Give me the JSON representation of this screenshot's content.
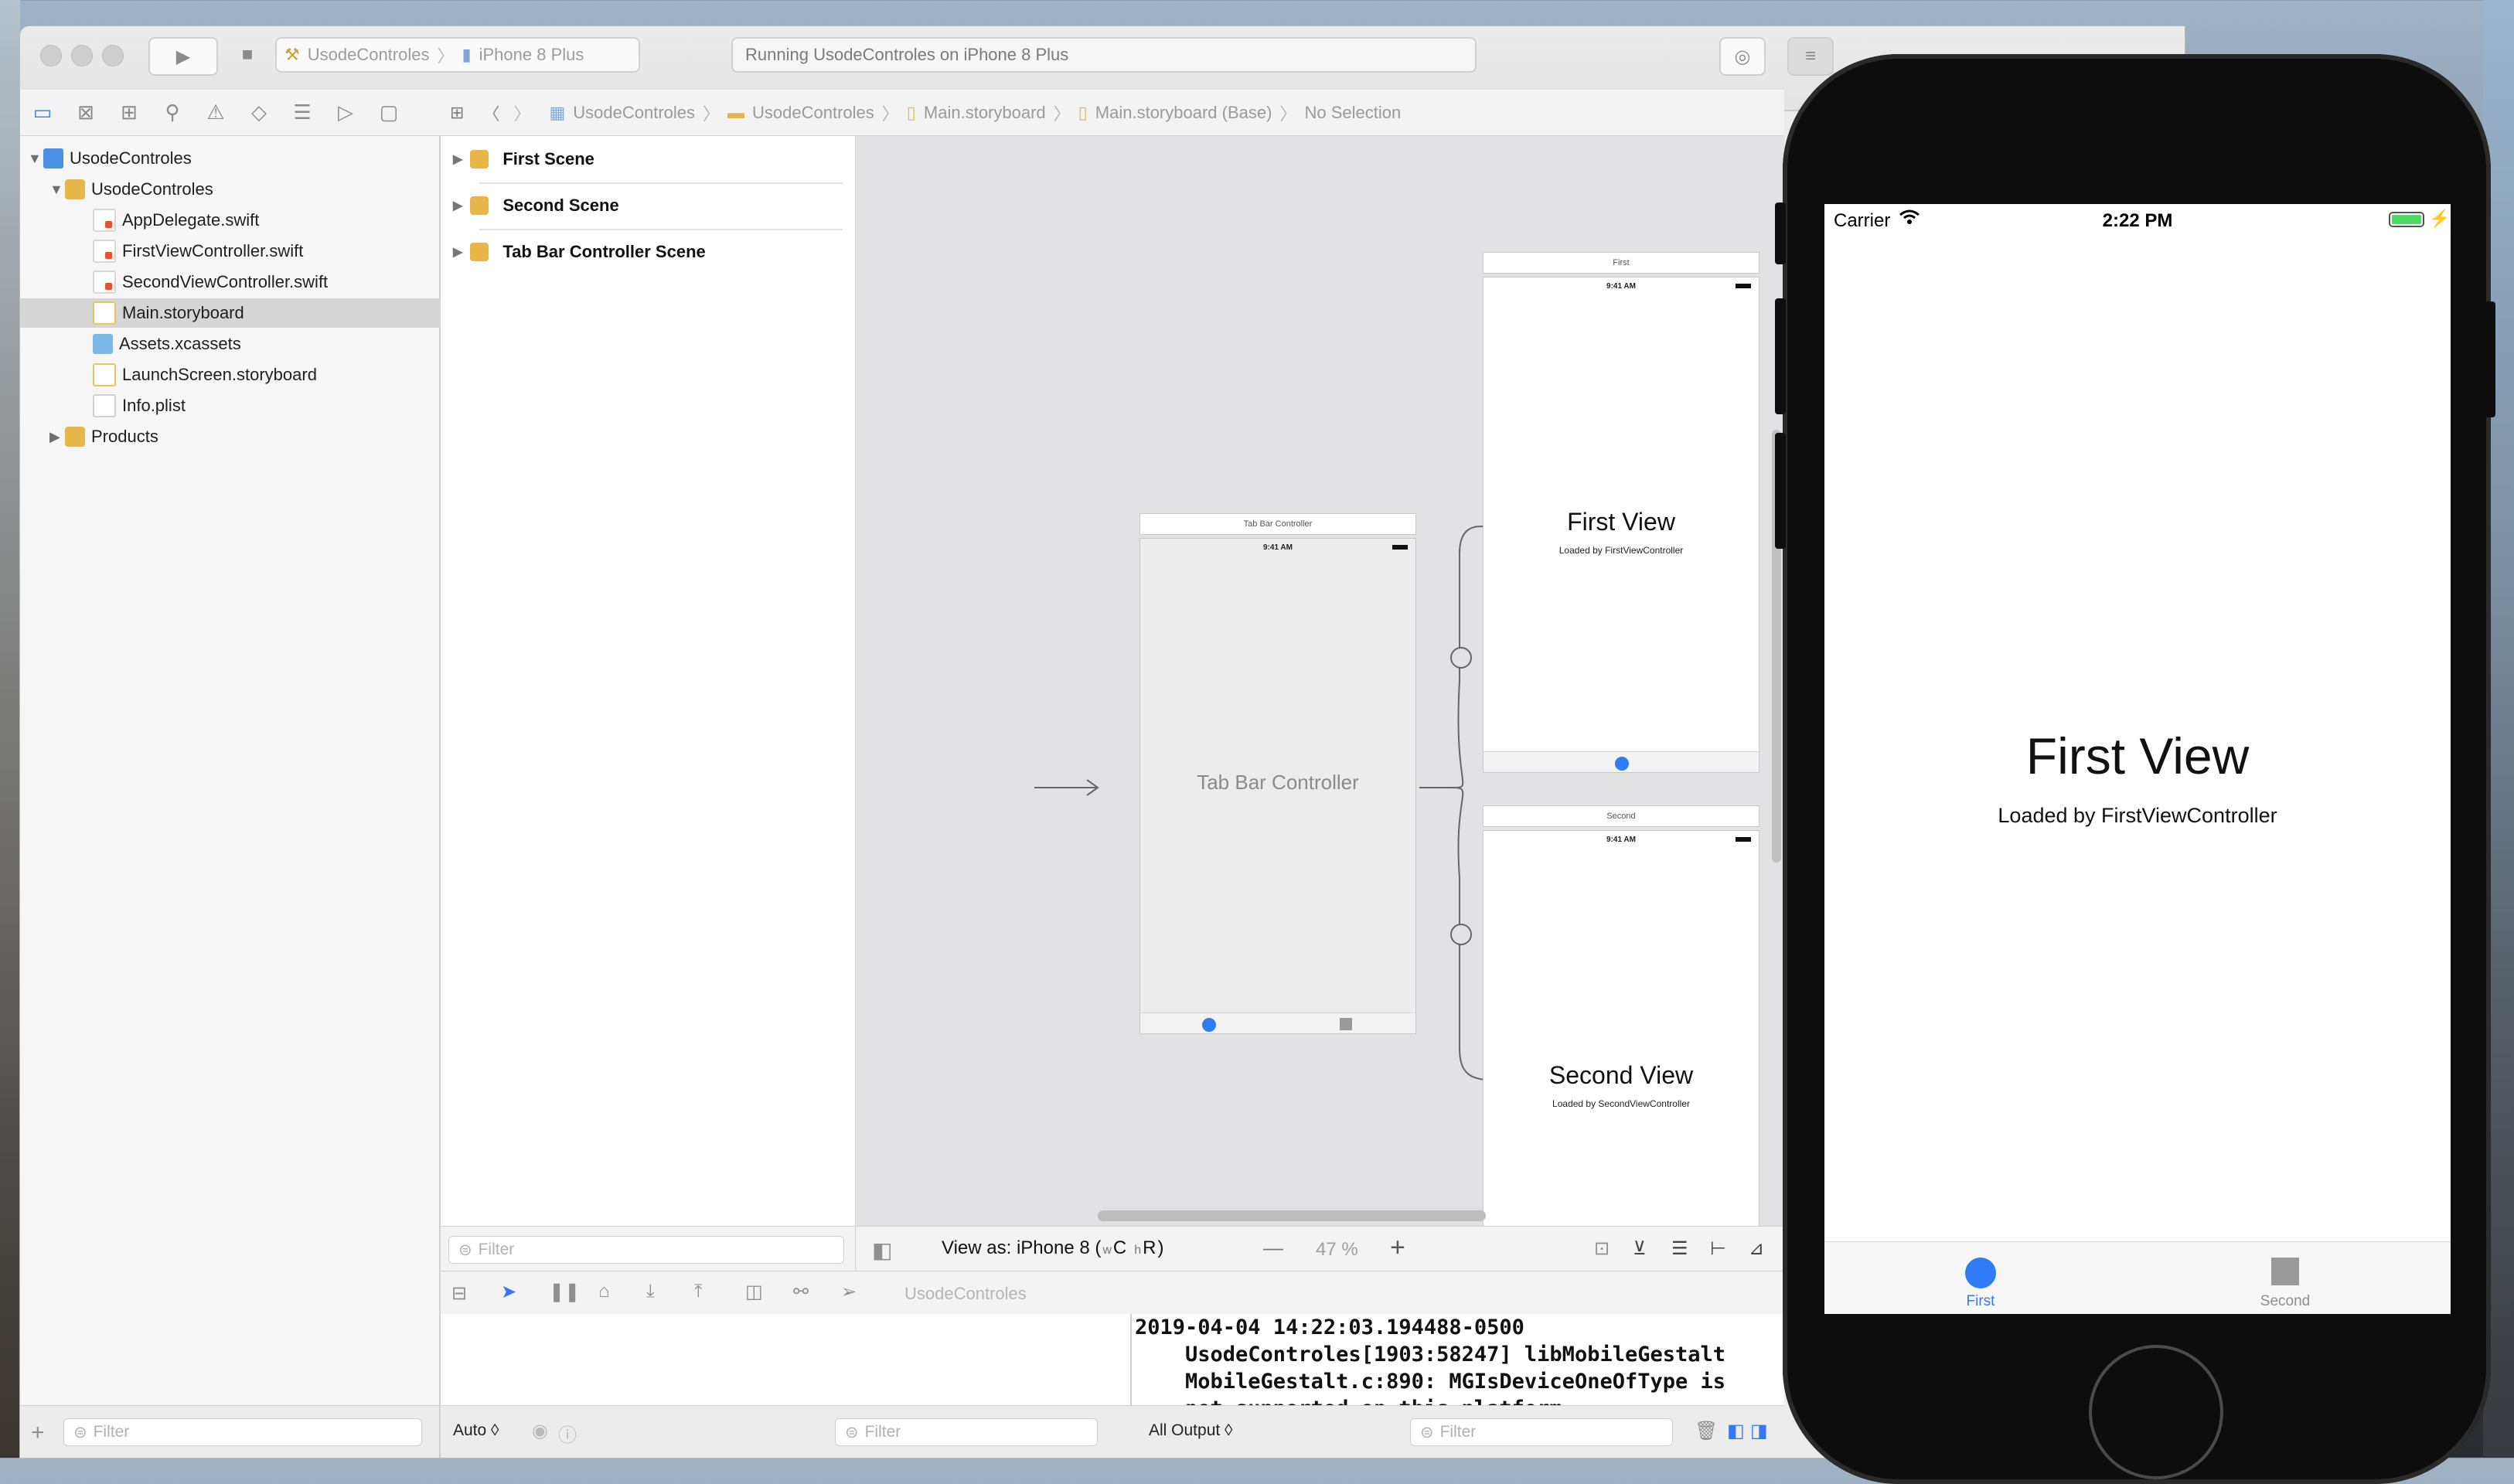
{
  "toolbar": {
    "scheme_project": "UsodeControles",
    "scheme_device": "iPhone 8 Plus",
    "activity": "Running UsodeControles on iPhone 8 Plus"
  },
  "navigator": {
    "items": [
      {
        "label": "UsodeControles",
        "type": "project"
      },
      {
        "label": "UsodeControles",
        "type": "folder"
      },
      {
        "label": "AppDelegate.swift",
        "type": "swift"
      },
      {
        "label": "FirstViewController.swift",
        "type": "swift"
      },
      {
        "label": "SecondViewController.swift",
        "type": "swift"
      },
      {
        "label": "Main.storyboard",
        "type": "storyboard",
        "selected": true
      },
      {
        "label": "Assets.xcassets",
        "type": "assets"
      },
      {
        "label": "LaunchScreen.storyboard",
        "type": "storyboard"
      },
      {
        "label": "Info.plist",
        "type": "plist"
      },
      {
        "label": "Products",
        "type": "folder"
      }
    ],
    "filter_placeholder": "Filter"
  },
  "jumpbar": {
    "crumbs": [
      "UsodeControles",
      "UsodeControles",
      "Main.storyboard",
      "Main.storyboard (Base)",
      "No Selection"
    ]
  },
  "outline": {
    "scenes": [
      "First Scene",
      "Second Scene",
      "Tab Bar Controller Scene"
    ],
    "filter_placeholder": "Filter"
  },
  "canvas": {
    "tab_bar_title": "Tab Bar Controller",
    "tab_bar_time": "9:41 AM",
    "tab_bar_center": "Tab Bar Controller",
    "first_title": "First",
    "first_time": "9:41 AM",
    "first_view": "First View",
    "first_sub": "Loaded by FirstViewController",
    "second_title": "Second",
    "second_time": "9:41 AM",
    "second_view": "Second View",
    "second_sub": "Loaded by SecondViewController",
    "view_as": "View as: iPhone 8 (",
    "size_class_w": "w",
    "size_class_c": "C",
    "size_class_h": "h",
    "size_class_r": "R",
    "view_as_end": ")",
    "zoom_minus": "—",
    "zoom": "47 %",
    "zoom_plus": "+"
  },
  "debug": {
    "target": "UsodeControles",
    "console_text": "2019-04-04 14:22:03.194488-0500\n    UsodeControles[1903:58247] libMobileGestalt\n    MobileGestalt.c:890: MGIsDeviceOneOfType is\n    not supported on this platform.",
    "auto_label": "Auto ◊",
    "filter_placeholder": "Filter",
    "output_label": "All Output ◊",
    "filter2_placeholder": "Filter"
  },
  "simulator": {
    "carrier": "Carrier",
    "time": "2:22 PM",
    "title": "First View",
    "subtitle": "Loaded by FirstViewController",
    "tab_first": "First",
    "tab_second": "Second",
    "accent": "#2f7cf6"
  }
}
